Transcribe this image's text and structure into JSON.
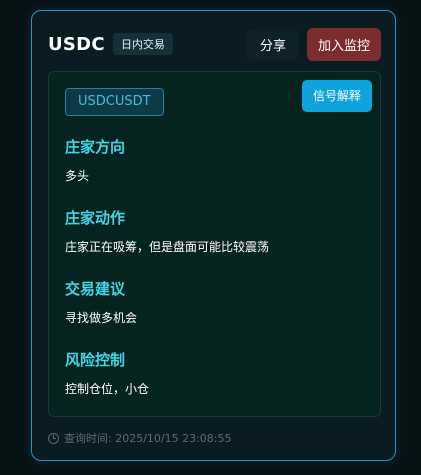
{
  "card": {
    "symbol": "USDC",
    "mode_badge": "日内交易",
    "share_label": "分享",
    "monitor_label": "加入监控"
  },
  "panel": {
    "pair": "USDCUSDT",
    "explain_label": "信号解释",
    "sections": [
      {
        "title": "庄家方向",
        "text": "多头"
      },
      {
        "title": "庄家动作",
        "text": "庄家正在吸筹，但是盘面可能比较震荡"
      },
      {
        "title": "交易建议",
        "text": "寻找做多机会"
      },
      {
        "title": "风险控制",
        "text": "控制仓位，小仓"
      }
    ]
  },
  "footer": {
    "icon": "clock-icon",
    "query_time": "查询时间: 2025/10/15 23:08:55"
  },
  "colors": {
    "background": "#071215",
    "card_border": "#2d8fbf",
    "accent_cyan": "#42d5e6",
    "explain_button": "#0fa3dd",
    "monitor_button": "#7c2b2f"
  }
}
